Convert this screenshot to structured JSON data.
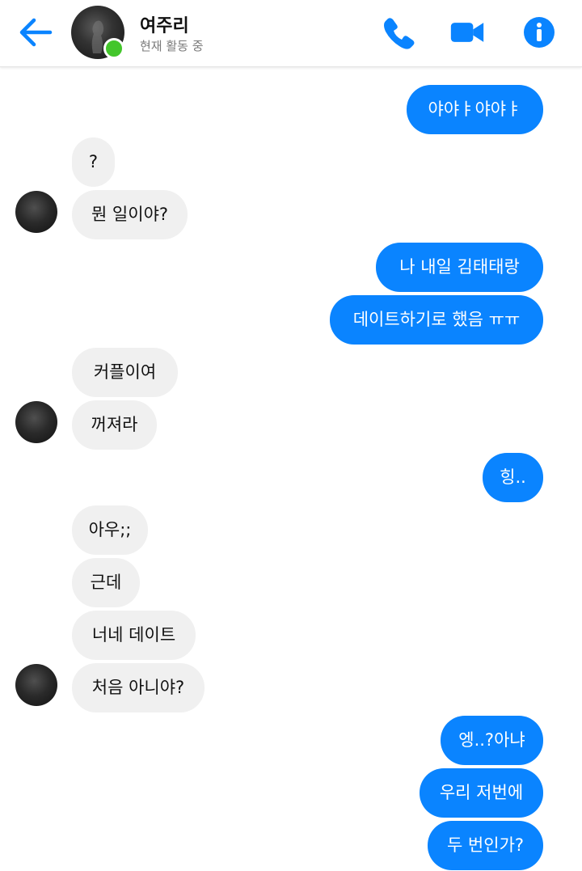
{
  "header": {
    "contact_name": "여주리",
    "status": "현재 활동 중",
    "icons": {
      "back": "back-arrow-icon",
      "call": "phone-icon",
      "video": "video-camera-icon",
      "info": "info-icon"
    },
    "accent_color": "#0a84ff",
    "active_color": "#43c62b"
  },
  "messages": [
    {
      "from": "me",
      "text": "야야ㅑ야야ㅑ"
    },
    {
      "from": "them",
      "text": "?"
    },
    {
      "from": "them",
      "text": "뭔 일이야?"
    },
    {
      "from": "me",
      "text": "나 내일 김태태랑"
    },
    {
      "from": "me",
      "text": "데이트하기로 했음 ㅠㅠ"
    },
    {
      "from": "them",
      "text": "커플이여"
    },
    {
      "from": "them",
      "text": "꺼져라"
    },
    {
      "from": "me",
      "text": "힝.."
    },
    {
      "from": "them",
      "text": "아우;;"
    },
    {
      "from": "them",
      "text": "근데"
    },
    {
      "from": "them",
      "text": "너네 데이트"
    },
    {
      "from": "them",
      "text": "처음 아니야?"
    },
    {
      "from": "me",
      "text": "엥..?아냐"
    },
    {
      "from": "me",
      "text": "우리 저번에"
    },
    {
      "from": "me",
      "text": "두 번인가?"
    }
  ]
}
